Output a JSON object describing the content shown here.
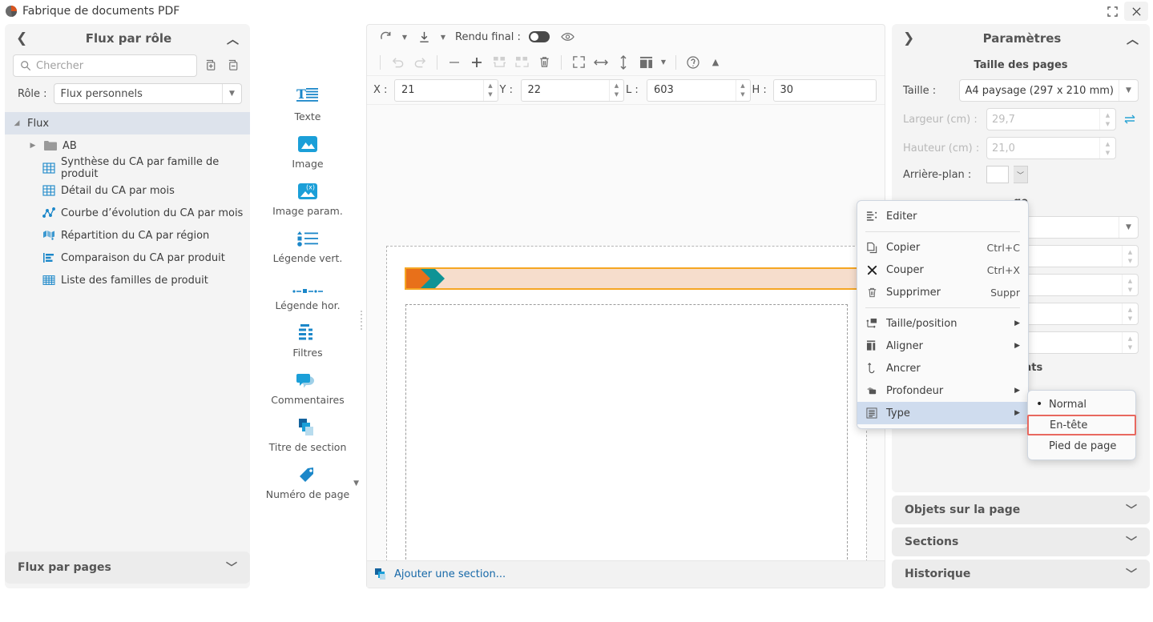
{
  "titlebar": {
    "title": "Fabrique de documents PDF",
    "restore_icon": "restore-window-icon",
    "close_icon": "close-icon"
  },
  "sidebar": {
    "header_title": "Flux par rôle",
    "back_icon": "chevron-left-icon",
    "collapse_icon": "chevron-up-icon",
    "search": {
      "placeholder": "Chercher",
      "value": "",
      "icon": "search-icon"
    },
    "add_icon": "add-flux-icon",
    "remove_icon": "remove-flux-icon",
    "role_label": "Rôle :",
    "role_value": "Flux personnels",
    "tree": [
      {
        "label": "Flux",
        "icon": "triangle-down-icon",
        "level": 0
      },
      {
        "label": "AB",
        "icon": "folder-icon",
        "level": 1
      },
      {
        "label": "Synthèse du CA par famille de produit",
        "icon": "table-icon",
        "level": 2
      },
      {
        "label": "Détail du CA par mois",
        "icon": "table-icon",
        "level": 2
      },
      {
        "label": "Courbe d’évolution du CA par mois",
        "icon": "line-chart-icon",
        "level": 2
      },
      {
        "label": "Répartition du CA par région",
        "icon": "map-icon",
        "level": 2
      },
      {
        "label": "Comparaison du CA par produit",
        "icon": "bar-chart-icon",
        "level": 2
      },
      {
        "label": "Liste des familles de produit",
        "icon": "grid-icon",
        "level": 2
      }
    ],
    "footer_label": "Flux par pages",
    "footer_icon": "chevron-down-icon"
  },
  "palette": {
    "tools": [
      {
        "label": "Texte",
        "icon": "text-object-icon"
      },
      {
        "label": "Image",
        "icon": "image-object-icon"
      },
      {
        "label": "Image param.",
        "icon": "parametrized-image-icon"
      },
      {
        "label": "Légende vert.",
        "icon": "vertical-legend-icon"
      },
      {
        "label": "Légende hor.",
        "icon": "horizontal-legend-icon"
      },
      {
        "label": "Filtres",
        "icon": "filters-icon"
      },
      {
        "label": "Commentaires",
        "icon": "comments-icon"
      },
      {
        "label": "Titre de section",
        "icon": "section-title-icon"
      },
      {
        "label": "Numéro de page",
        "icon": "page-number-icon"
      }
    ],
    "more_icon": "chevron-down-icon"
  },
  "editor": {
    "toolbar_top": {
      "refresh_icon": "refresh-icon",
      "refresh_caret": "chevron-down-icon",
      "download_icon": "download-icon",
      "download_caret": "chevron-down-icon",
      "render_label": "Rendu final :",
      "toggle_icon": "toggle-switch-off",
      "preview_icon": "eye-icon"
    },
    "toolbar_main": {
      "undo_icon": "undo-icon",
      "redo_icon": "redo-icon",
      "zoom_out_icon": "minus-icon",
      "zoom_in_icon": "plus-icon",
      "group_icon": "group-icon",
      "ungroup_icon": "ungroup-icon",
      "delete_icon": "trash-icon",
      "fit_page_icon": "fit-page-icon",
      "fit_width_icon": "fit-width-icon",
      "fit_height_icon": "fit-height-icon",
      "layout_icon": "layout-icon",
      "layout_caret": "chevron-down-icon",
      "help_icon": "help-icon",
      "collapse_icon": "triangle-up-icon"
    },
    "coords": [
      {
        "label": "X :",
        "value": "21"
      },
      {
        "label": "Y :",
        "value": "22"
      },
      {
        "label": "L :",
        "value": "603"
      },
      {
        "label": "H :",
        "value": "30"
      }
    ],
    "band": {
      "handle_icon": "gears-icon",
      "band_fill": "#f6ddcc",
      "band_border": "#f5a623",
      "logo_orange": "#e8701a",
      "logo_teal": "#0f9395",
      "handle_border": "#e8685f"
    },
    "add_section_label": "Ajouter une section...",
    "add_section_icon": "add-section-icon",
    "add_section_color": "#1668a8"
  },
  "context_menu": {
    "items": [
      {
        "label": "Editer",
        "shortcut": "",
        "icon": "edit-list-icon",
        "submenu": false,
        "selected": false
      },
      {
        "label": "Copier",
        "shortcut": "Ctrl+C",
        "icon": "copy-icon",
        "submenu": false,
        "selected": false
      },
      {
        "label": "Couper",
        "shortcut": "Ctrl+X",
        "icon": "cut-x-icon",
        "submenu": false,
        "selected": false
      },
      {
        "label": "Supprimer",
        "shortcut": "Suppr",
        "icon": "trash-icon",
        "submenu": false,
        "selected": false
      },
      {
        "label": "Taille/position",
        "shortcut": "",
        "icon": "size-position-icon",
        "submenu": true,
        "selected": false
      },
      {
        "label": "Aligner",
        "shortcut": "",
        "icon": "align-icon",
        "submenu": true,
        "selected": false
      },
      {
        "label": "Ancrer",
        "shortcut": "",
        "icon": "anchor-icon",
        "submenu": false,
        "selected": false
      },
      {
        "label": "Profondeur",
        "shortcut": "",
        "icon": "depth-icon",
        "submenu": true,
        "selected": false
      },
      {
        "label": "Type",
        "shortcut": "",
        "icon": "type-icon",
        "submenu": true,
        "selected": true
      }
    ]
  },
  "submenu": {
    "items": [
      {
        "label": "Normal",
        "checked": true,
        "highlighted": false
      },
      {
        "label": "En-tête",
        "checked": false,
        "highlighted": true
      },
      {
        "label": "Pied de page",
        "checked": false,
        "highlighted": false
      }
    ],
    "highlight_color": "#e8685f"
  },
  "right_panel": {
    "header_title": "Paramètres",
    "expand_icon": "chevron-right-icon",
    "collapse_icon": "chevron-up-icon",
    "page_size_title": "Taille des pages",
    "size_label": "Taille :",
    "size_value": "A4 paysage (297 x 210 mm)",
    "width_label": "Largeur (cm) :",
    "width_value": "29,7",
    "height_label": "Hauteur (cm) :",
    "height_value": "21,0",
    "swap_icon": "swap-orientation-icon",
    "background_label": "Arrière-plan :",
    "background_color": "#ffffff",
    "margins_title_partial": "ge",
    "elements_title_partial": "éments",
    "accordions": [
      {
        "label": "Objets sur la page",
        "icon": "chevron-down-icon"
      },
      {
        "label": "Sections",
        "icon": "chevron-down-icon"
      },
      {
        "label": "Historique",
        "icon": "chevron-down-icon"
      }
    ]
  }
}
